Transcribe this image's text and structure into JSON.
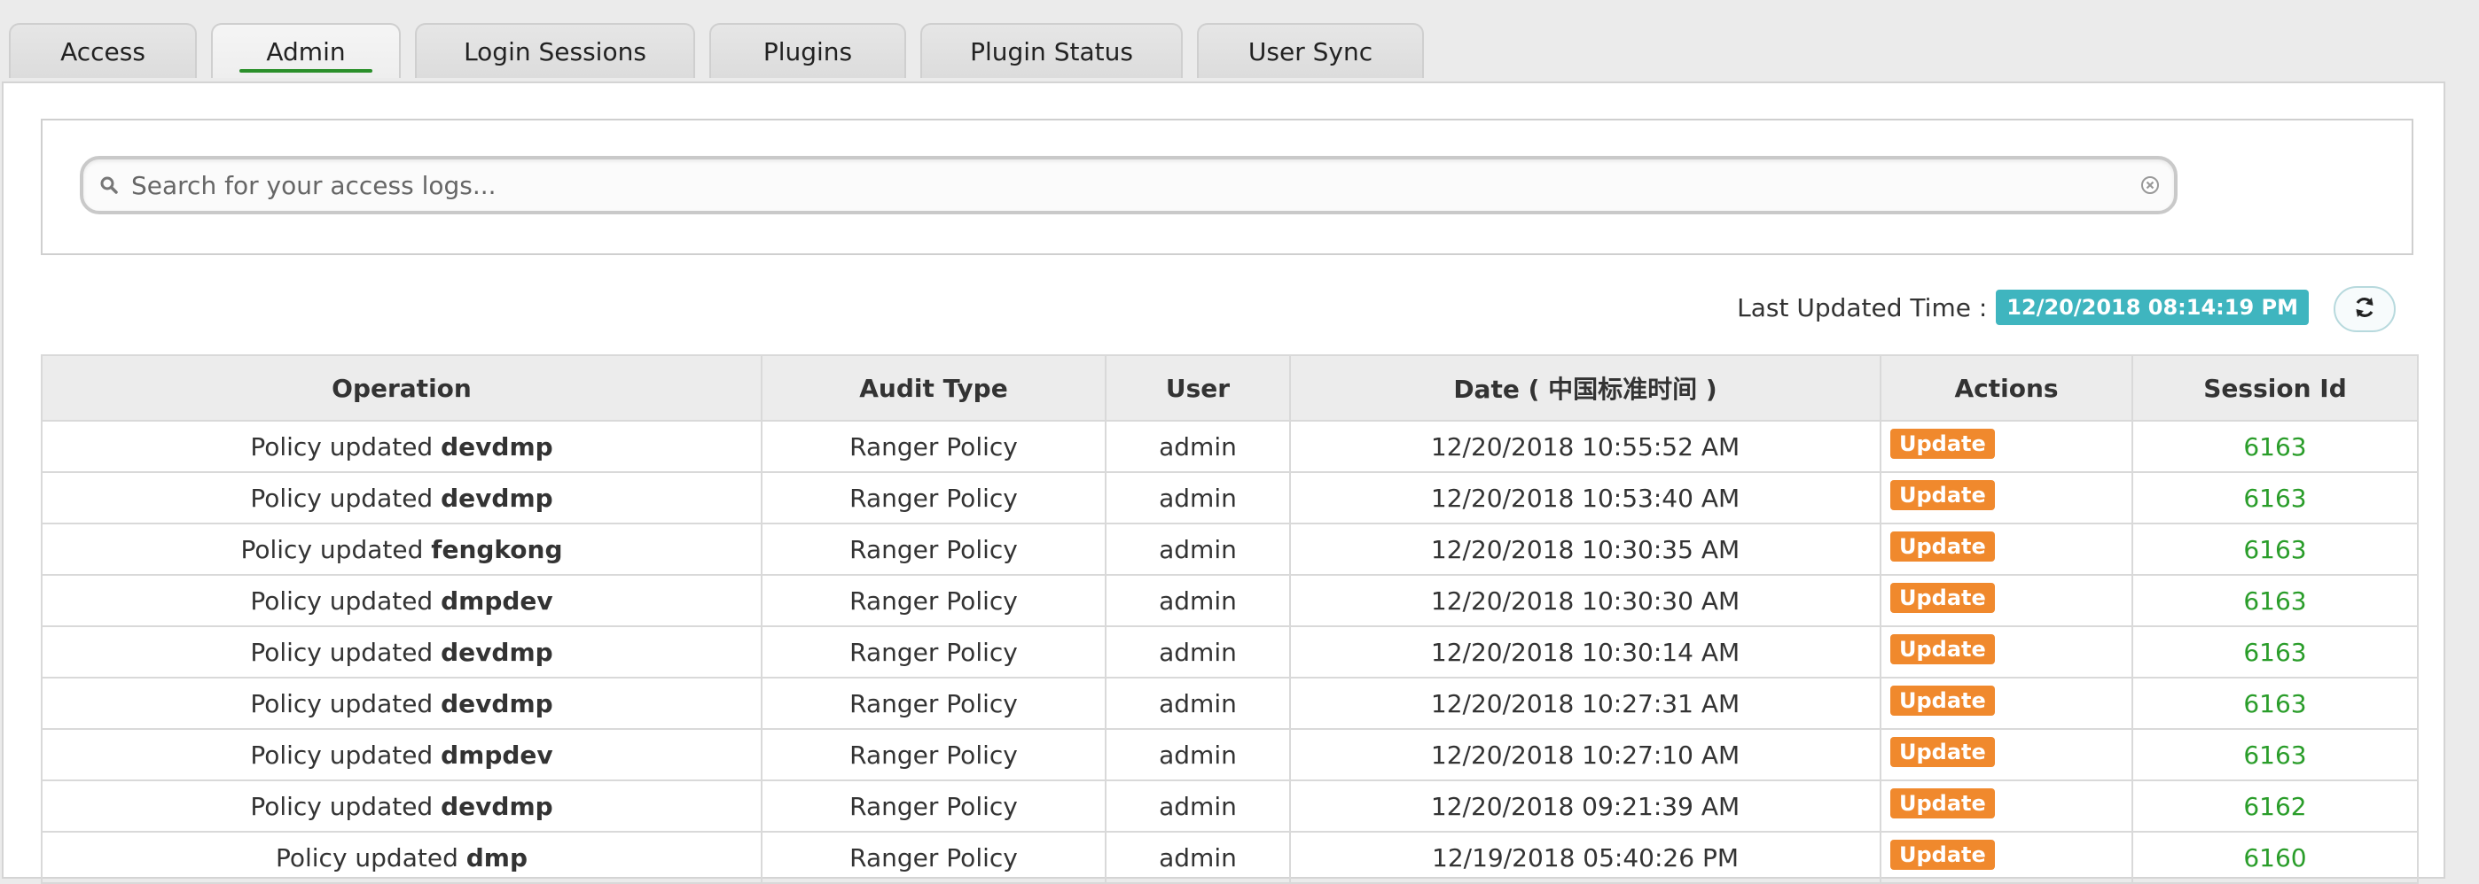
{
  "tabs": [
    {
      "label": "Access",
      "active": false
    },
    {
      "label": "Admin",
      "active": true
    },
    {
      "label": "Login Sessions",
      "active": false
    },
    {
      "label": "Plugins",
      "active": false
    },
    {
      "label": "Plugin Status",
      "active": false
    },
    {
      "label": "User Sync",
      "active": false
    }
  ],
  "search": {
    "placeholder": "Search for your access logs...",
    "value": ""
  },
  "status": {
    "last_updated_label": "Last Updated Time :",
    "last_updated_value": "12/20/2018 08:14:19 PM"
  },
  "table": {
    "headers": [
      "Operation",
      "Audit Type",
      "User",
      "Date ( 中国标准时间 )",
      "Actions",
      "Session Id"
    ],
    "rows": [
      {
        "op_prefix": "Policy updated",
        "op_name": "devdmp",
        "audit_type": "Ranger Policy",
        "user": "admin",
        "date": "12/20/2018 10:55:52 AM",
        "action": "Update",
        "session_id": "6163"
      },
      {
        "op_prefix": "Policy updated",
        "op_name": "devdmp",
        "audit_type": "Ranger Policy",
        "user": "admin",
        "date": "12/20/2018 10:53:40 AM",
        "action": "Update",
        "session_id": "6163"
      },
      {
        "op_prefix": "Policy updated",
        "op_name": "fengkong",
        "audit_type": "Ranger Policy",
        "user": "admin",
        "date": "12/20/2018 10:30:35 AM",
        "action": "Update",
        "session_id": "6163"
      },
      {
        "op_prefix": "Policy updated",
        "op_name": "dmpdev",
        "audit_type": "Ranger Policy",
        "user": "admin",
        "date": "12/20/2018 10:30:30 AM",
        "action": "Update",
        "session_id": "6163"
      },
      {
        "op_prefix": "Policy updated",
        "op_name": "devdmp",
        "audit_type": "Ranger Policy",
        "user": "admin",
        "date": "12/20/2018 10:30:14 AM",
        "action": "Update",
        "session_id": "6163"
      },
      {
        "op_prefix": "Policy updated",
        "op_name": "devdmp",
        "audit_type": "Ranger Policy",
        "user": "admin",
        "date": "12/20/2018 10:27:31 AM",
        "action": "Update",
        "session_id": "6163"
      },
      {
        "op_prefix": "Policy updated",
        "op_name": "dmpdev",
        "audit_type": "Ranger Policy",
        "user": "admin",
        "date": "12/20/2018 10:27:10 AM",
        "action": "Update",
        "session_id": "6163"
      },
      {
        "op_prefix": "Policy updated",
        "op_name": "devdmp",
        "audit_type": "Ranger Policy",
        "user": "admin",
        "date": "12/20/2018 09:21:39 AM",
        "action": "Update",
        "session_id": "6162"
      },
      {
        "op_prefix": "Policy updated",
        "op_name": "dmp",
        "audit_type": "Ranger Policy",
        "user": "admin",
        "date": "12/19/2018 05:40:26 PM",
        "action": "Update",
        "session_id": "6160"
      }
    ]
  },
  "colors": {
    "active_tab_underline": "#2a8f2a",
    "time_badge": "#3fb5bf",
    "action_badge": "#f0892d",
    "session_link": "#2a9d2a"
  },
  "icons": {
    "search": "search-icon",
    "clear": "close-circle-icon",
    "refresh": "refresh-icon"
  }
}
